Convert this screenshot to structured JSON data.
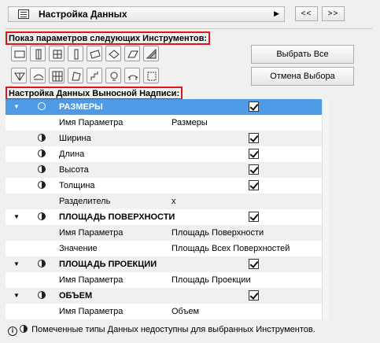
{
  "header": {
    "title": "Настройка Данных",
    "menu_icon": "list-menu-icon",
    "arrow": "▶"
  },
  "nav": {
    "prev": "<<",
    "next": ">>"
  },
  "tools_label": "Показ параметров следующих Инструментов:",
  "tools": [
    "slab-tool",
    "door-tool",
    "window-tool",
    "column-tool",
    "beam-tool",
    "object-tool",
    "roof-tool",
    "fill-tool",
    "mesh-tool",
    "shell-tool",
    "curtain-wall-tool",
    "morph-tool",
    "stair-tool",
    "lamp-tool",
    "railing-tool",
    "zone-tool"
  ],
  "buttons": {
    "select_all": "Выбрать Все",
    "deselect": "Отмена Выбора"
  },
  "label_section": "Настройка Данных Выносной Надписи:",
  "rows": [
    {
      "type": "group",
      "label": "РАЗМЕРЫ",
      "value": "",
      "checked": true,
      "selected": true
    },
    {
      "type": "param",
      "label": "Имя Параметра",
      "value": "Размеры",
      "checked": false
    },
    {
      "type": "item",
      "label": "Ширина",
      "value": "",
      "checked": true
    },
    {
      "type": "item",
      "label": "Длина",
      "value": "",
      "checked": true
    },
    {
      "type": "item",
      "label": "Высота",
      "value": "",
      "checked": true
    },
    {
      "type": "item",
      "label": "Толщина",
      "value": "",
      "checked": true
    },
    {
      "type": "param",
      "label": "Разделитель",
      "value": "x",
      "checked": false
    },
    {
      "type": "group",
      "label": "ПЛОЩАДЬ ПОВЕРХНОСТИ",
      "value": "",
      "checked": true
    },
    {
      "type": "param",
      "label": "Имя Параметра",
      "value": "Площадь Поверхности",
      "checked": false
    },
    {
      "type": "param",
      "label": "Значение",
      "value": "Площадь Всех Поверхностей",
      "checked": false
    },
    {
      "type": "group",
      "label": "ПЛОЩАДЬ ПРОЕКЦИИ",
      "value": "",
      "checked": true
    },
    {
      "type": "param",
      "label": "Имя Параметра",
      "value": "Площадь Проекции",
      "checked": false
    },
    {
      "type": "group",
      "label": "ОБЪЕМ",
      "value": "",
      "checked": true
    },
    {
      "type": "param",
      "label": "Имя Параметра",
      "value": "Объем",
      "checked": false
    }
  ],
  "footer": {
    "text": "Помеченные типы Данных недоступны для выбранных Инструментов.",
    "info_icon": "i"
  }
}
